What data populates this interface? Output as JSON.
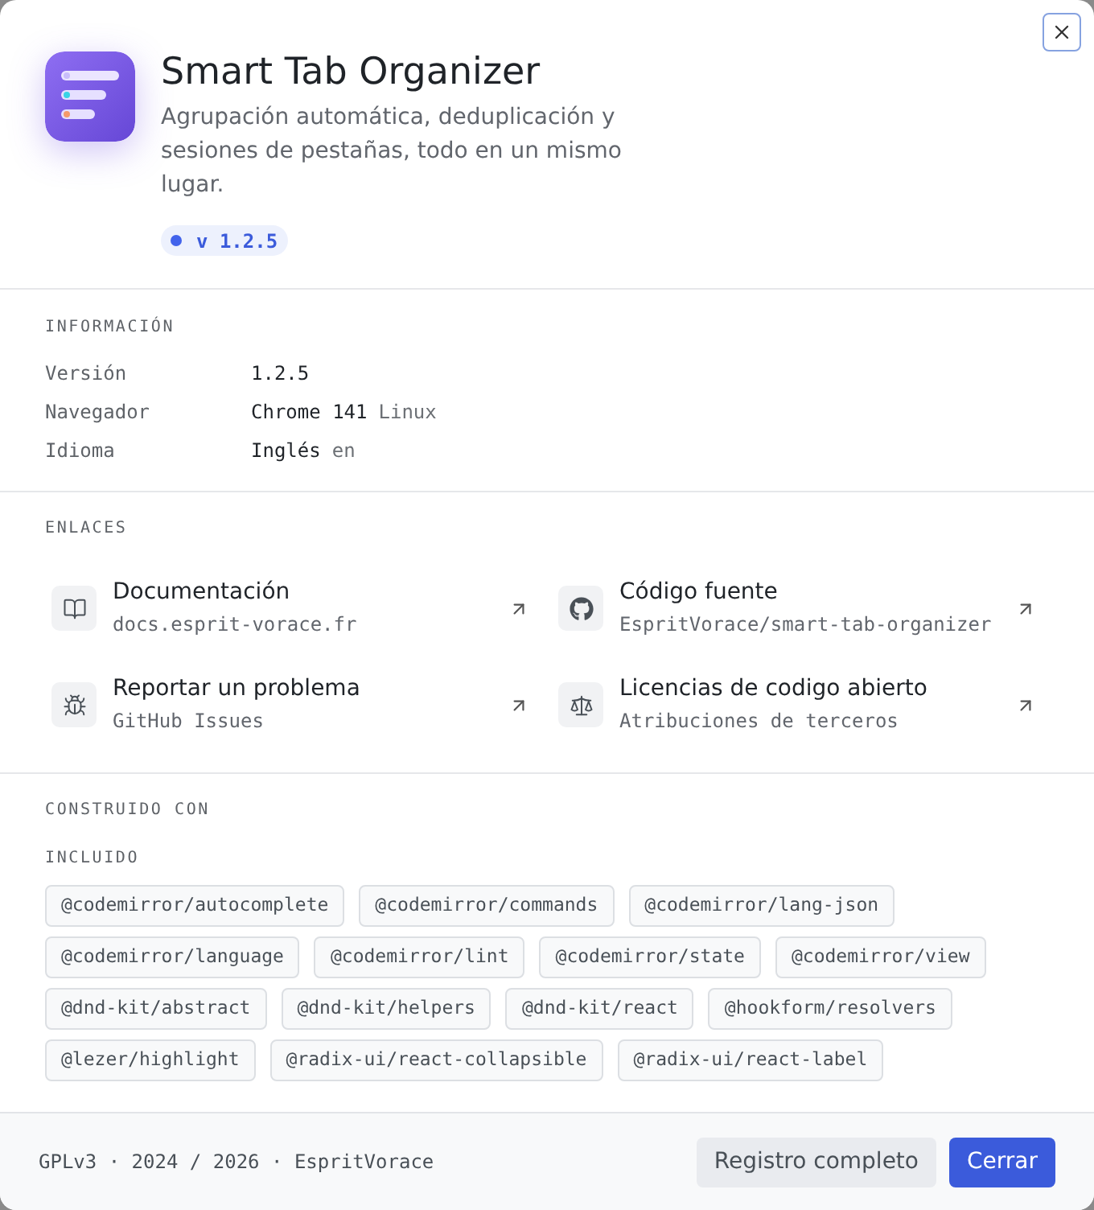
{
  "header": {
    "title": "Smart Tab Organizer",
    "description": "Agrupación automática, deduplicación y sesiones de pestañas, todo en un mismo lugar.",
    "version": "v 1.2.5"
  },
  "info": {
    "heading": "INFORMACIÓN",
    "rows": [
      {
        "label": "Versión",
        "value": "1.2.5"
      },
      {
        "label": "Navegador",
        "value": "Chrome 141",
        "detail": "Linux"
      },
      {
        "label": "Idioma",
        "value": "Inglés",
        "detail": "en"
      }
    ]
  },
  "links": {
    "heading": "ENLACES",
    "items": [
      {
        "title": "Documentación",
        "subtitle": "docs.esprit-vorace.fr"
      },
      {
        "title": "Código fuente",
        "subtitle": "EspritVorace/smart-tab-organizer"
      },
      {
        "title": "Reportar un problema",
        "subtitle": "GitHub Issues"
      },
      {
        "title": "Licencias de codigo abierto",
        "subtitle": "Atribuciones de terceros"
      }
    ]
  },
  "built_with": {
    "heading": "CONSTRUIDO CON",
    "groups": [
      {
        "heading": "INCLUIDO",
        "packages": [
          "@codemirror/autocomplete",
          "@codemirror/commands",
          "@codemirror/lang-json",
          "@codemirror/language",
          "@codemirror/lint",
          "@codemirror/state",
          "@codemirror/view",
          "@dnd-kit/abstract",
          "@dnd-kit/helpers",
          "@dnd-kit/react",
          "@hookform/resolvers",
          "@lezer/highlight",
          "@radix-ui/react-collapsible",
          "@radix-ui/react-label"
        ]
      }
    ]
  },
  "footer": {
    "text": "GPLv3 · 2024 / 2026 · EspritVorace",
    "buttons": [
      {
        "label": "Registro completo",
        "kind": "secondary"
      },
      {
        "label": "Cerrar",
        "kind": "primary"
      }
    ]
  }
}
